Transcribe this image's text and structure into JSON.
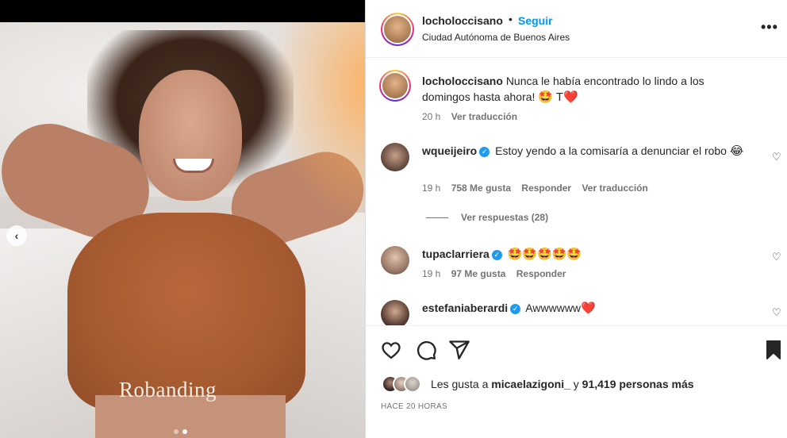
{
  "post": {
    "username": "locholoccisano",
    "separator": "•",
    "follow_label": "Seguir",
    "location": "Ciudad Autónoma de Buenos Aires",
    "more_icon": "more-horizontal-icon",
    "media": {
      "watermark_text": "Robanding",
      "slide_count": 2,
      "active_slide": 2,
      "prev_icon": "chevron-left-icon"
    }
  },
  "caption": {
    "username": "locholoccisano",
    "text": "Nunca le había encontrado lo lindo a los domingos hasta ahora!",
    "emojis": "🤩 T❤️",
    "time": "20 h",
    "translate_label": "Ver traducción"
  },
  "comments": [
    {
      "username": "wqueijeiro",
      "verified": true,
      "text": "Estoy yendo a la comisaría a denunciar el robo",
      "emojis": "😂",
      "time": "19 h",
      "likes": "758 Me gusta",
      "reply_label": "Responder",
      "translate_label": "Ver traducción",
      "view_replies": "Ver respuestas (28)"
    },
    {
      "username": "tupaclarriera",
      "verified": true,
      "text": "",
      "emojis": "🤩🤩🤩🤩🤩",
      "time": "19 h",
      "likes": "97 Me gusta",
      "reply_label": "Responder"
    },
    {
      "username": "estefaniaberardi",
      "verified": true,
      "text": "Awwwwww",
      "emojis": "❤️"
    }
  ],
  "likes": {
    "prefix": "Les gusta a",
    "user": "micaelazigoni_",
    "connector": "y",
    "count": "91,419 personas más"
  },
  "timestamp": "HACE 20 HORAS",
  "colors": {
    "follow_blue": "#0095f6",
    "verified_blue": "#1d9bf0",
    "heart_red": "#ed1c24",
    "muted_text": "#737373"
  }
}
